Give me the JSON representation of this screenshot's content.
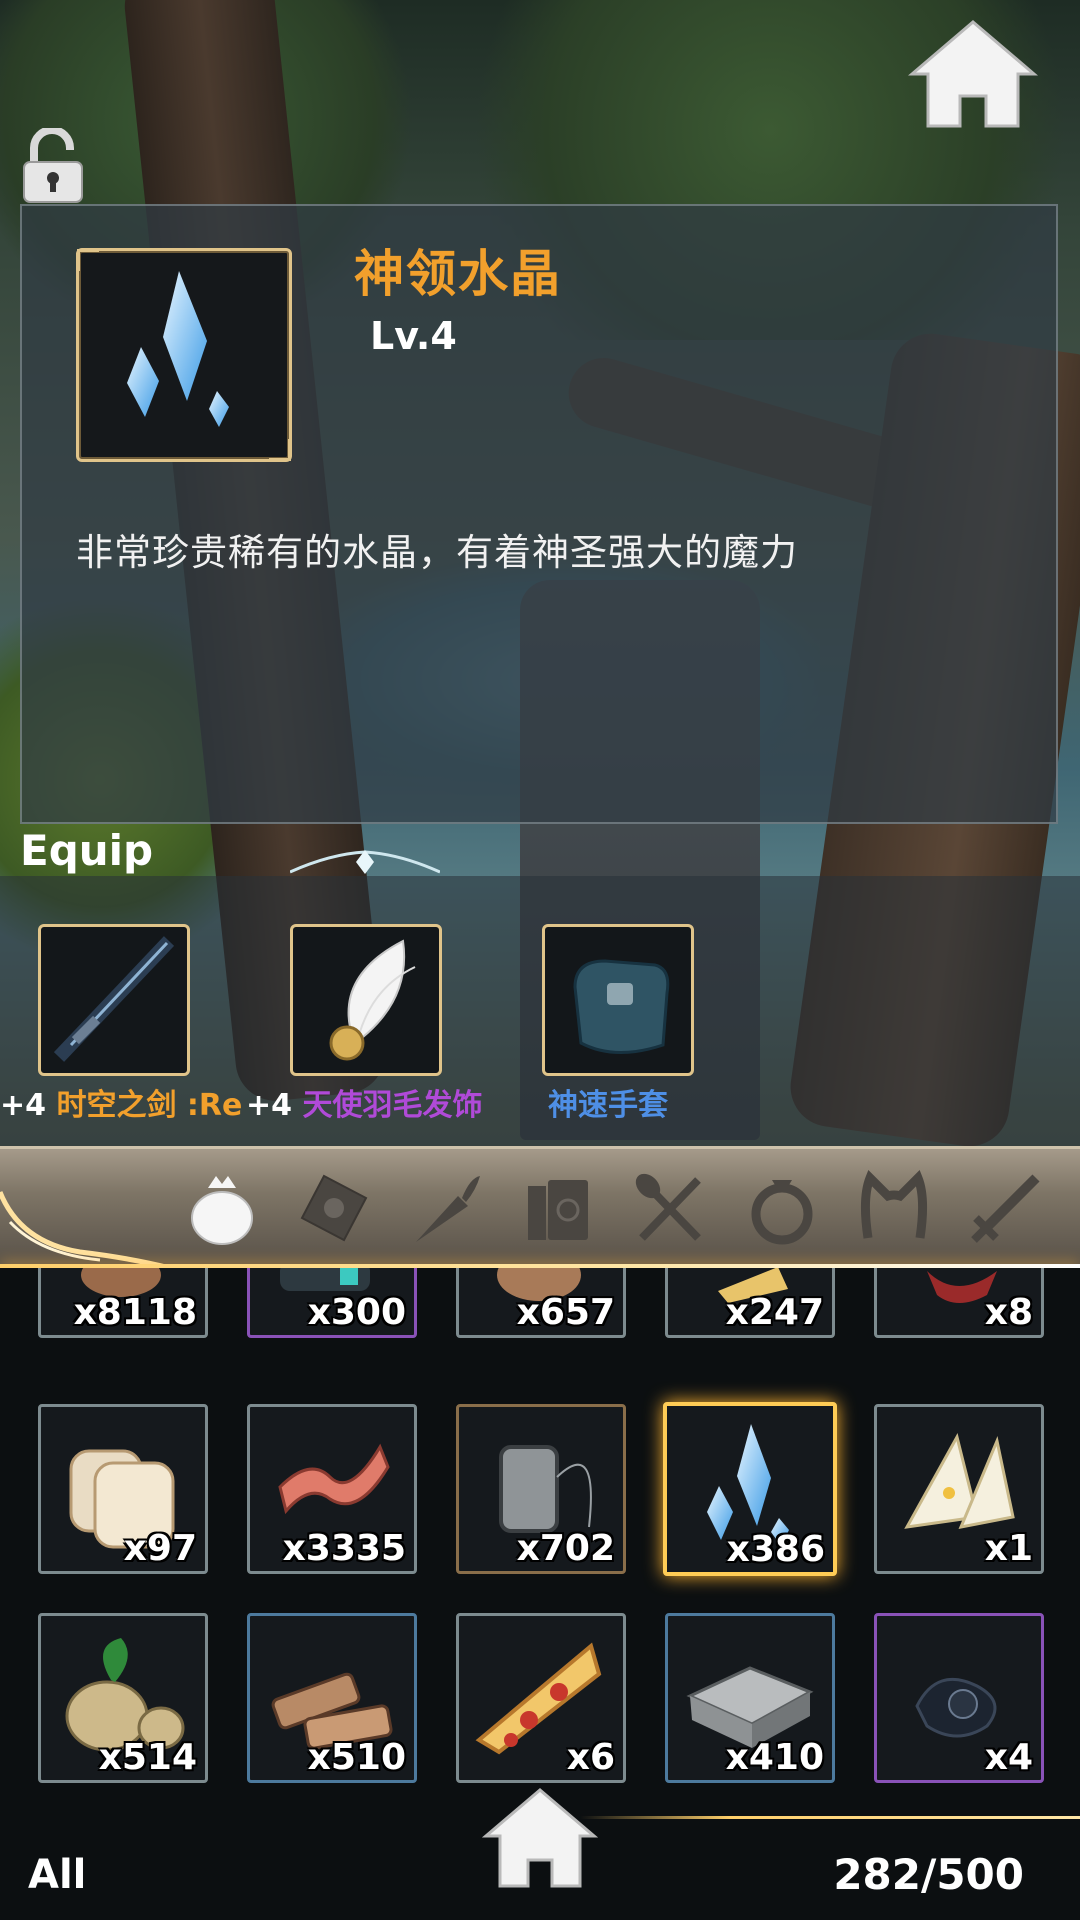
{
  "colors": {
    "item_name": "#f2a02c",
    "legendary": "#f2a02c",
    "epic": "#b04ad8",
    "rare": "#4e8fe6",
    "selected_border": "#ffcc55",
    "frame_gold": "#e0c48a"
  },
  "top": {
    "home_icon": "home-icon",
    "lock_icon": "unlock-icon"
  },
  "item_detail": {
    "name": "神领水晶",
    "level": "Lv.4",
    "description": "非常珍贵稀有的水晶，有着神圣强大的魔力",
    "icon": "crystal-icon"
  },
  "equip": {
    "title": "Equip",
    "items": [
      {
        "plus": "+4",
        "name": "时空之剑 :Re",
        "color": "#f2a02c",
        "icon": "sword-icon"
      },
      {
        "plus": "+4",
        "name": "天使羽毛发饰",
        "color": "#b04ad8",
        "icon": "feather-hairpin-icon"
      },
      {
        "plus": "",
        "name": "神速手套",
        "color": "#4e8fe6",
        "icon": "gloves-icon"
      }
    ]
  },
  "categories": [
    {
      "name": "bag",
      "icon": "bag-icon",
      "active": true
    },
    {
      "name": "scroll",
      "icon": "scroll-icon",
      "active": false
    },
    {
      "name": "food",
      "icon": "carrot-icon",
      "active": false
    },
    {
      "name": "books",
      "icon": "books-icon",
      "active": false
    },
    {
      "name": "cooking",
      "icon": "fork-spoon-icon",
      "active": false
    },
    {
      "name": "ring",
      "icon": "ring-icon",
      "active": false
    },
    {
      "name": "headwear",
      "icon": "cat-ears-icon",
      "active": false
    },
    {
      "name": "weapon",
      "icon": "sword-icon",
      "active": false
    }
  ],
  "inventory": {
    "rows": [
      [
        {
          "qty": "x8118",
          "icon": "log-icon",
          "rarity": "gray"
        },
        {
          "qty": "x300",
          "icon": "mechanical-part-icon",
          "rarity": "purple"
        },
        {
          "qty": "x657",
          "icon": "sack-icon",
          "rarity": "gray"
        },
        {
          "qty": "x247",
          "icon": "cheese-icon",
          "rarity": "gray"
        },
        {
          "qty": "x8",
          "icon": "red-cloth-icon",
          "rarity": "gray"
        }
      ],
      [
        {
          "qty": "x97",
          "icon": "bread-icon",
          "rarity": "gray"
        },
        {
          "qty": "x3335",
          "icon": "meat-strip-icon",
          "rarity": "gray"
        },
        {
          "qty": "x702",
          "icon": "thread-spool-icon",
          "rarity": "brown"
        },
        {
          "qty": "x386",
          "icon": "crystal-icon",
          "rarity": "gray",
          "selected": true
        },
        {
          "qty": "x1",
          "icon": "sandwich-icon",
          "rarity": "gray"
        }
      ],
      [
        {
          "qty": "x514",
          "icon": "potato-icon",
          "rarity": "gray"
        },
        {
          "qty": "x510",
          "icon": "wood-planks-icon",
          "rarity": "blue"
        },
        {
          "qty": "x6",
          "icon": "pizza-icon",
          "rarity": "gray"
        },
        {
          "qty": "x410",
          "icon": "stone-block-icon",
          "rarity": "blue"
        },
        {
          "qty": "x4",
          "icon": "dark-orb-icon",
          "rarity": "purple"
        }
      ]
    ]
  },
  "footer": {
    "filter": "All",
    "count": "282/500"
  }
}
